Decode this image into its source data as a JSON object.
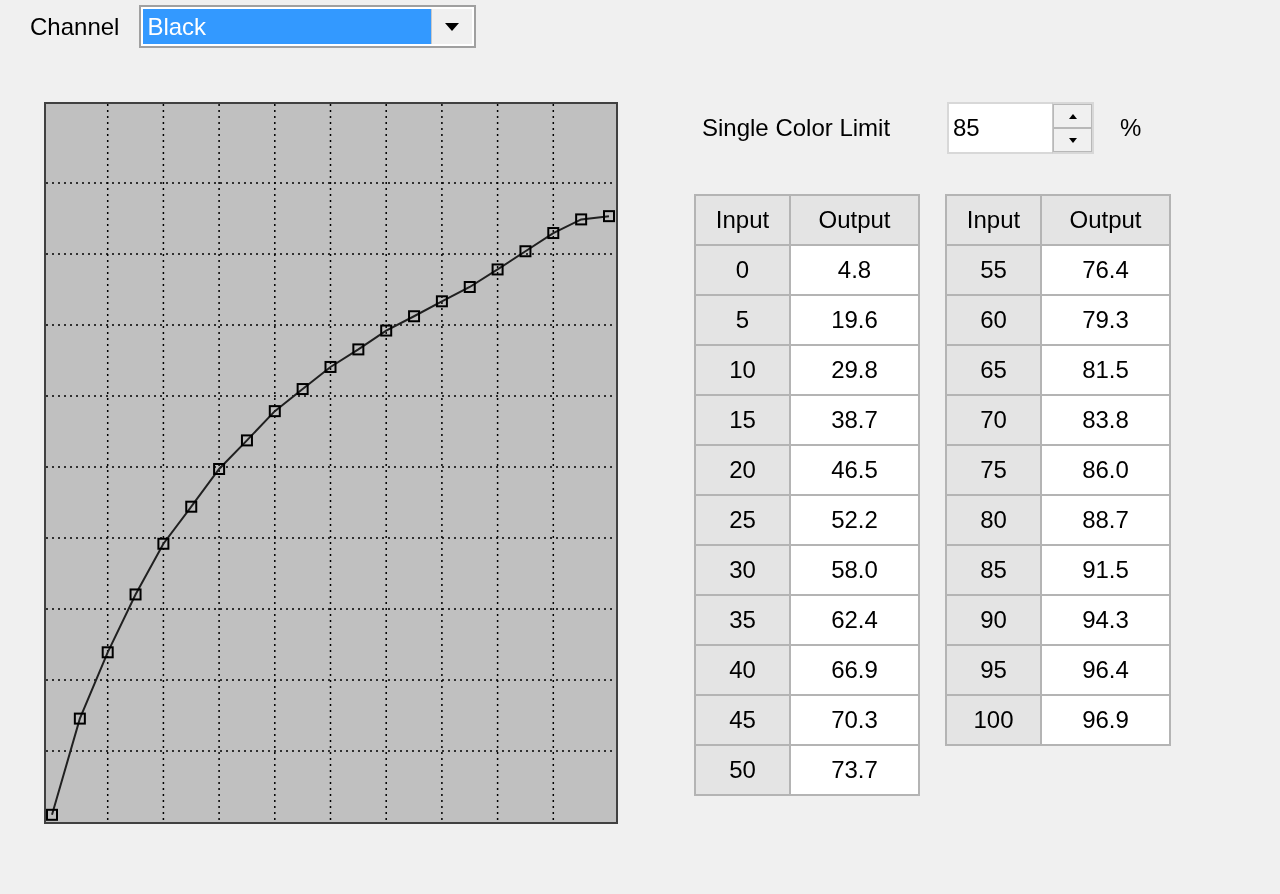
{
  "channel": {
    "label": "Channel",
    "value": "Black"
  },
  "single_color_limit": {
    "label": "Single Color Limit",
    "value": "85",
    "unit": "%"
  },
  "tables": [
    {
      "columns": [
        "Input",
        "Output"
      ],
      "rows": [
        {
          "input": "0",
          "output": "4.8"
        },
        {
          "input": "5",
          "output": "19.6"
        },
        {
          "input": "10",
          "output": "29.8"
        },
        {
          "input": "15",
          "output": "38.7"
        },
        {
          "input": "20",
          "output": "46.5"
        },
        {
          "input": "25",
          "output": "52.2"
        },
        {
          "input": "30",
          "output": "58.0"
        },
        {
          "input": "35",
          "output": "62.4"
        },
        {
          "input": "40",
          "output": "66.9"
        },
        {
          "input": "45",
          "output": "70.3"
        },
        {
          "input": "50",
          "output": "73.7"
        }
      ]
    },
    {
      "columns": [
        "Input",
        "Output"
      ],
      "rows": [
        {
          "input": "55",
          "output": "76.4"
        },
        {
          "input": "60",
          "output": "79.3"
        },
        {
          "input": "65",
          "output": "81.5"
        },
        {
          "input": "70",
          "output": "83.8"
        },
        {
          "input": "75",
          "output": "86.0"
        },
        {
          "input": "80",
          "output": "88.7"
        },
        {
          "input": "85",
          "output": "91.5"
        },
        {
          "input": "90",
          "output": "94.3"
        },
        {
          "input": "95",
          "output": "96.4"
        },
        {
          "input": "100",
          "output": "96.9"
        }
      ]
    }
  ]
}
